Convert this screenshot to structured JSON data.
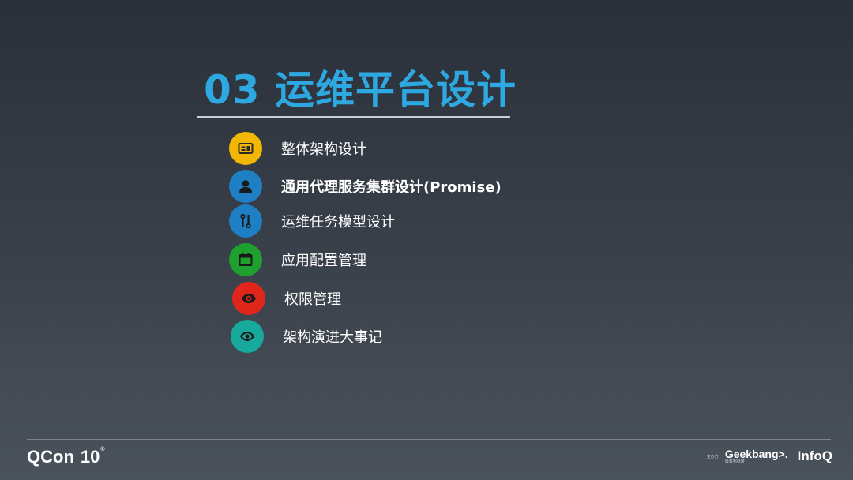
{
  "slide": {
    "title": "03 运维平台设计"
  },
  "agenda": [
    {
      "label": "整体架构设计",
      "icon": "id-card-icon",
      "color": "#f2b705"
    },
    {
      "label": "通用代理服务集群设计(Promise)",
      "icon": "user-icon",
      "color": "#1f7fc4"
    },
    {
      "label": "运维任务模型设计",
      "icon": "tools-icon",
      "color": "#1f7fc4"
    },
    {
      "label": "应用配置管理",
      "icon": "calendar-icon",
      "color": "#1fa12f"
    },
    {
      "label": "权限管理",
      "icon": "eye-icon",
      "color": "#e0261b"
    },
    {
      "label": "架构演进大事记",
      "icon": "eye-cycle-icon",
      "color": "#17a99b"
    }
  ],
  "footer": {
    "left_logo": "QCon",
    "left_num": "10",
    "host_label": "主办方",
    "geek_logo": "Geekbang>.",
    "geek_sub": "极客邦科技",
    "infoq_logo": "InfoQ"
  }
}
